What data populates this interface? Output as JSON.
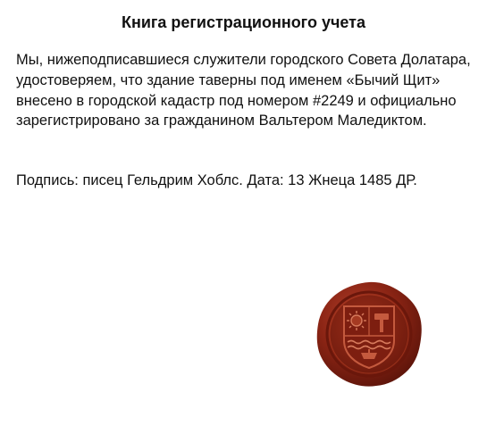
{
  "document": {
    "title": "Книга регистрационного учета",
    "body": "Мы, нижеподписавшиеся служители городского Совета Долатара, удостоверяем, что здание таверны под именем «Бычий Щит» внесено в городской кадастр под номером #2249 и официально зарегистрировано за гражданином Вальтером Maледиктом.",
    "signature": "Подпись: писец Гельдрим Хоблс. Дата: 13 Жнеца 1485 ДР."
  },
  "seal": {
    "icon": "wax-seal-icon",
    "emblems": [
      "sun",
      "hammer",
      "waves",
      "ship"
    ],
    "wax_color": "#8a2414",
    "wax_dark": "#5c140a",
    "wax_light": "#b5412c"
  }
}
